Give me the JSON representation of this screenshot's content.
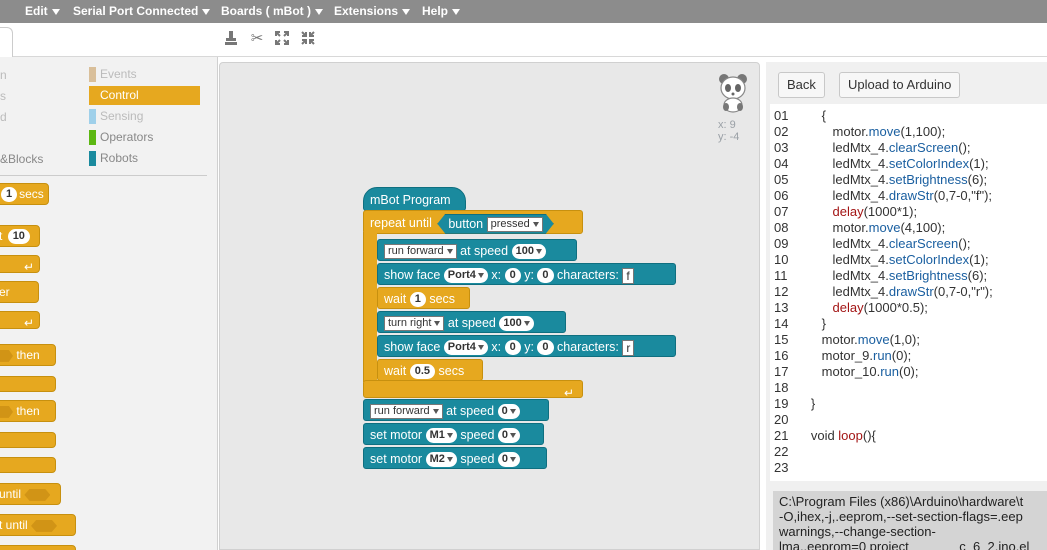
{
  "menu": [
    {
      "label": "Edit"
    },
    {
      "label": "Serial Port Connected"
    },
    {
      "label": "Boards ( mBot )"
    },
    {
      "label": "Extensions"
    },
    {
      "label": "Help"
    }
  ],
  "palette": {
    "left_fragments": [
      "n",
      "s",
      "d",
      "&Blocks"
    ],
    "categories": [
      {
        "label": "Events",
        "color": "#d9bf9a"
      },
      {
        "label": "Control",
        "color": "#e6a81f",
        "selected": true
      },
      {
        "label": "Sensing",
        "color": "#9fd0ea"
      },
      {
        "label": "Operators",
        "color": "#5cb712"
      },
      {
        "label": "Robots",
        "color": "#1a8a9e"
      }
    ],
    "blocks": {
      "b1_value": "1",
      "b1_text": "secs",
      "b2_prefix": "t",
      "b2_value": "10",
      "b4_text": "er",
      "b6_text": "then",
      "b8_text": "then",
      "b11_text": "until",
      "b12_text": "t until"
    }
  },
  "script": {
    "sprite_x": "x: 9",
    "sprite_y": "y: -4",
    "hat": "mBot Program",
    "repeat_until": "repeat until",
    "button_label": "button",
    "button_state": "pressed",
    "blocks": [
      {
        "dd": "run forward",
        "at": "at speed",
        "val": "100"
      },
      {
        "show": "show face",
        "port": "Port4",
        "x": "x:",
        "xv": "0",
        "y": "y:",
        "yv": "0",
        "ch": "characters:",
        "chv": "f"
      },
      {
        "wait": "wait",
        "val": "1",
        "unit": "secs"
      },
      {
        "dd": "turn right",
        "at": "at speed",
        "val": "100"
      },
      {
        "show": "show face",
        "port": "Port4",
        "x": "x:",
        "xv": "0",
        "y": "y:",
        "yv": "0",
        "ch": "characters:",
        "chv": "r"
      },
      {
        "wait": "wait",
        "val": "0.5",
        "unit": "secs"
      }
    ],
    "after": [
      {
        "dd": "run forward",
        "at": "at speed",
        "val": "0"
      },
      {
        "label": "set motor",
        "motor": "M1",
        "at": "speed",
        "val": "0"
      },
      {
        "label": "set motor",
        "motor": "M2",
        "at": "speed",
        "val": "0"
      }
    ]
  },
  "right": {
    "back": "Back",
    "upload": "Upload to Arduino"
  },
  "code": [
    {
      "n": "01",
      "pre": "      {",
      "fn": "",
      "post": ""
    },
    {
      "n": "02",
      "pre": "         motor.",
      "fn": "move",
      "post": "(1,100);"
    },
    {
      "n": "03",
      "pre": "         ledMtx_4.",
      "fn": "clearScreen",
      "post": "();"
    },
    {
      "n": "04",
      "pre": "         ledMtx_4.",
      "fn": "setColorIndex",
      "post": "(1);"
    },
    {
      "n": "05",
      "pre": "         ledMtx_4.",
      "fn": "setBrightness",
      "post": "(6);"
    },
    {
      "n": "06",
      "pre": "         ledMtx_4.",
      "fn": "drawStr",
      "post": "(0,7-0,\"f\");"
    },
    {
      "n": "07",
      "pre": "         ",
      "kw": "delay",
      "post": "(1000*1);"
    },
    {
      "n": "08",
      "pre": "         motor.",
      "fn": "move",
      "post": "(4,100);"
    },
    {
      "n": "09",
      "pre": "         ledMtx_4.",
      "fn": "clearScreen",
      "post": "();"
    },
    {
      "n": "10",
      "pre": "         ledMtx_4.",
      "fn": "setColorIndex",
      "post": "(1);"
    },
    {
      "n": "11",
      "pre": "         ledMtx_4.",
      "fn": "setBrightness",
      "post": "(6);"
    },
    {
      "n": "12",
      "pre": "         ledMtx_4.",
      "fn": "drawStr",
      "post": "(0,7-0,\"r\");"
    },
    {
      "n": "13",
      "pre": "         ",
      "kw": "delay",
      "post": "(1000*0.5);"
    },
    {
      "n": "14",
      "pre": "      }",
      "fn": "",
      "post": ""
    },
    {
      "n": "15",
      "pre": "      motor.",
      "fn": "move",
      "post": "(1,0);"
    },
    {
      "n": "16",
      "pre": "      motor_9.",
      "fn": "run",
      "post": "(0);"
    },
    {
      "n": "17",
      "pre": "      motor_10.",
      "fn": "run",
      "post": "(0);"
    },
    {
      "n": "18",
      "pre": "",
      "fn": "",
      "post": ""
    },
    {
      "n": "19",
      "pre": "   }",
      "fn": "",
      "post": ""
    },
    {
      "n": "20",
      "pre": "",
      "fn": "",
      "post": ""
    },
    {
      "n": "21",
      "pre": "   void ",
      "kw": "loop",
      "post": "(){"
    },
    {
      "n": "22",
      "pre": "",
      "fn": "",
      "post": ""
    },
    {
      "n": "23",
      "pre": "",
      "fn": "",
      "post": ""
    }
  ],
  "console": {
    "line1": "C:\\Program Files (x86)\\Arduino\\hardware\\t",
    "line2": "-O,ihex,-j,.eeprom,--set-section-flags=.eep",
    "line3": "warnings,--change-section-",
    "line4": "lma,.eeprom=0 project_______c_6_2.ino.el"
  }
}
